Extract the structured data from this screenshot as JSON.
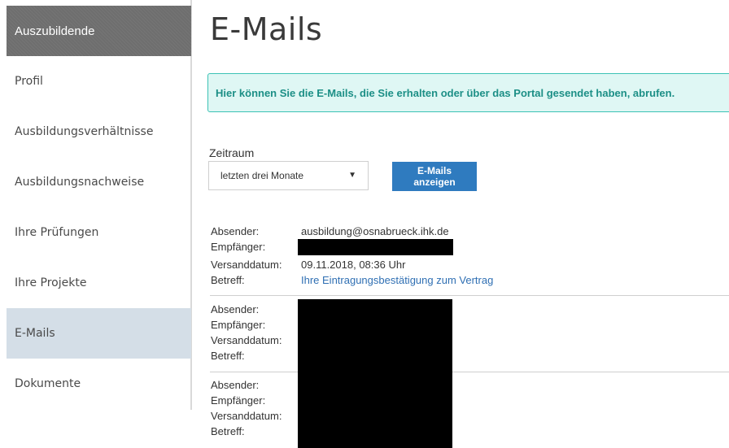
{
  "sidebar": {
    "header": "Auszubildende",
    "items": [
      {
        "label": "Profil"
      },
      {
        "label": "Ausbildungsverhältnisse"
      },
      {
        "label": "Ausbildungsnachweise"
      },
      {
        "label": "Ihre Prüfungen"
      },
      {
        "label": "Ihre Projekte"
      },
      {
        "label": "E-Mails"
      },
      {
        "label": "Dokumente"
      }
    ],
    "active_item": "E-Mails"
  },
  "main": {
    "title": "E-Mails",
    "info": "Hier können Sie die E-Mails, die Sie erhalten oder über das Portal gesendet haben, abrufen.",
    "filter": {
      "label": "Zeitraum",
      "selected": "letzten drei Monate",
      "button_label": "E-Mails anzeigen"
    },
    "labels": {
      "sender": "Absender:",
      "recipient": "Empfänger:",
      "date": "Versanddatum:",
      "subject": "Betreff:"
    },
    "emails": [
      {
        "sender": "ausbildung@osnabrueck.ihk.de",
        "date": "09.11.2018, 08:36 Uhr",
        "subject": "Ihre Eintragungsbestätigung zum Vertrag"
      },
      {},
      {}
    ]
  },
  "colors": {
    "sidebar_header": "#6e6e6e",
    "sidebar_active": "#d4dee7",
    "info_border": "#3cc2b5",
    "info_background": "#dff7f4",
    "info_text": "#1c8f86",
    "button": "#2f7bbf",
    "link": "#2f6fb3"
  }
}
